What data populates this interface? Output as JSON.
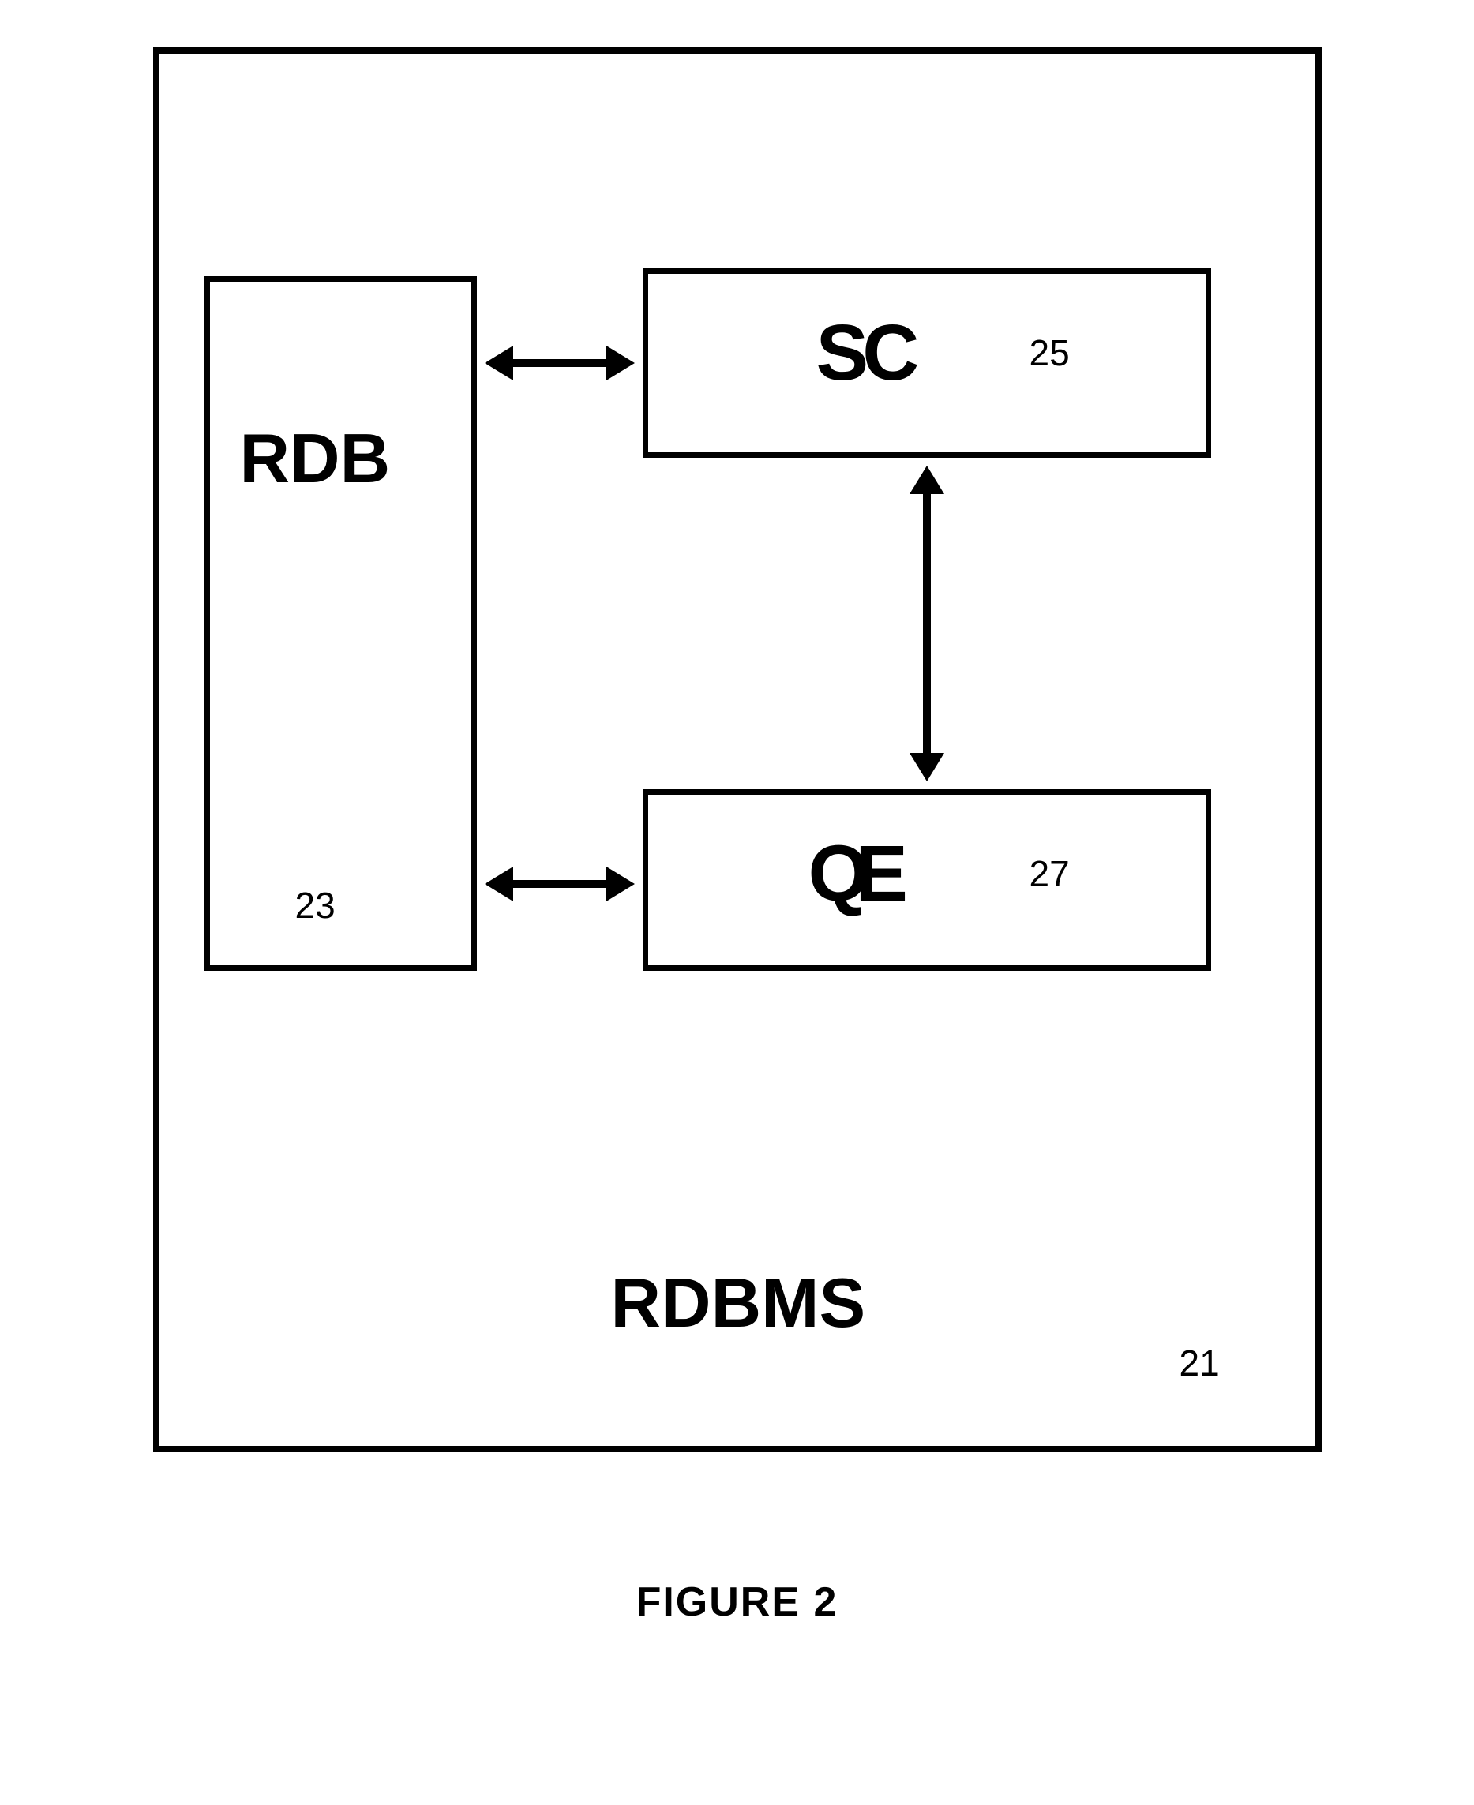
{
  "chart_data": {
    "type": "diagram",
    "title": "FIGURE 2",
    "container": {
      "label": "RDBMS",
      "ref": "21"
    },
    "blocks": [
      {
        "id": "rdb",
        "label": "RDB",
        "ref": "23"
      },
      {
        "id": "sc",
        "label": "SC",
        "ref": "25"
      },
      {
        "id": "qe",
        "label": "QE",
        "ref": "27"
      }
    ],
    "connections": [
      {
        "from": "rdb",
        "to": "sc",
        "bidirectional": true
      },
      {
        "from": "rdb",
        "to": "qe",
        "bidirectional": true
      },
      {
        "from": "sc",
        "to": "qe",
        "bidirectional": true
      }
    ]
  }
}
